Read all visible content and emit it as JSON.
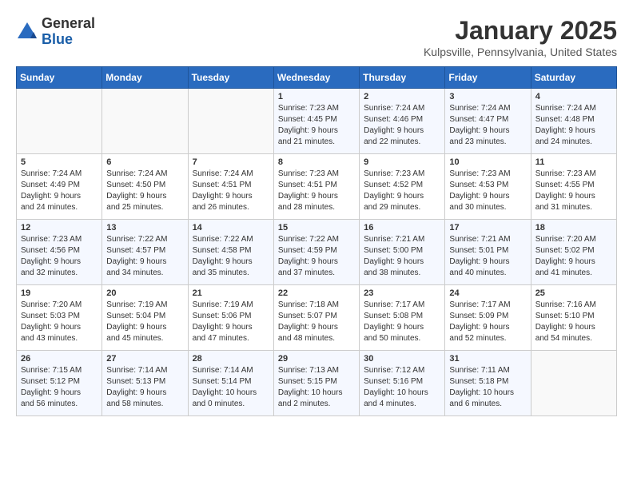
{
  "header": {
    "logo_line1": "General",
    "logo_line2": "Blue",
    "month_title": "January 2025",
    "location": "Kulpsville, Pennsylvania, United States"
  },
  "days_of_week": [
    "Sunday",
    "Monday",
    "Tuesday",
    "Wednesday",
    "Thursday",
    "Friday",
    "Saturday"
  ],
  "weeks": [
    [
      {
        "day": "",
        "info": ""
      },
      {
        "day": "",
        "info": ""
      },
      {
        "day": "",
        "info": ""
      },
      {
        "day": "1",
        "info": "Sunrise: 7:23 AM\nSunset: 4:45 PM\nDaylight: 9 hours\nand 21 minutes."
      },
      {
        "day": "2",
        "info": "Sunrise: 7:24 AM\nSunset: 4:46 PM\nDaylight: 9 hours\nand 22 minutes."
      },
      {
        "day": "3",
        "info": "Sunrise: 7:24 AM\nSunset: 4:47 PM\nDaylight: 9 hours\nand 23 minutes."
      },
      {
        "day": "4",
        "info": "Sunrise: 7:24 AM\nSunset: 4:48 PM\nDaylight: 9 hours\nand 24 minutes."
      }
    ],
    [
      {
        "day": "5",
        "info": "Sunrise: 7:24 AM\nSunset: 4:49 PM\nDaylight: 9 hours\nand 24 minutes."
      },
      {
        "day": "6",
        "info": "Sunrise: 7:24 AM\nSunset: 4:50 PM\nDaylight: 9 hours\nand 25 minutes."
      },
      {
        "day": "7",
        "info": "Sunrise: 7:24 AM\nSunset: 4:51 PM\nDaylight: 9 hours\nand 26 minutes."
      },
      {
        "day": "8",
        "info": "Sunrise: 7:23 AM\nSunset: 4:51 PM\nDaylight: 9 hours\nand 28 minutes."
      },
      {
        "day": "9",
        "info": "Sunrise: 7:23 AM\nSunset: 4:52 PM\nDaylight: 9 hours\nand 29 minutes."
      },
      {
        "day": "10",
        "info": "Sunrise: 7:23 AM\nSunset: 4:53 PM\nDaylight: 9 hours\nand 30 minutes."
      },
      {
        "day": "11",
        "info": "Sunrise: 7:23 AM\nSunset: 4:55 PM\nDaylight: 9 hours\nand 31 minutes."
      }
    ],
    [
      {
        "day": "12",
        "info": "Sunrise: 7:23 AM\nSunset: 4:56 PM\nDaylight: 9 hours\nand 32 minutes."
      },
      {
        "day": "13",
        "info": "Sunrise: 7:22 AM\nSunset: 4:57 PM\nDaylight: 9 hours\nand 34 minutes."
      },
      {
        "day": "14",
        "info": "Sunrise: 7:22 AM\nSunset: 4:58 PM\nDaylight: 9 hours\nand 35 minutes."
      },
      {
        "day": "15",
        "info": "Sunrise: 7:22 AM\nSunset: 4:59 PM\nDaylight: 9 hours\nand 37 minutes."
      },
      {
        "day": "16",
        "info": "Sunrise: 7:21 AM\nSunset: 5:00 PM\nDaylight: 9 hours\nand 38 minutes."
      },
      {
        "day": "17",
        "info": "Sunrise: 7:21 AM\nSunset: 5:01 PM\nDaylight: 9 hours\nand 40 minutes."
      },
      {
        "day": "18",
        "info": "Sunrise: 7:20 AM\nSunset: 5:02 PM\nDaylight: 9 hours\nand 41 minutes."
      }
    ],
    [
      {
        "day": "19",
        "info": "Sunrise: 7:20 AM\nSunset: 5:03 PM\nDaylight: 9 hours\nand 43 minutes."
      },
      {
        "day": "20",
        "info": "Sunrise: 7:19 AM\nSunset: 5:04 PM\nDaylight: 9 hours\nand 45 minutes."
      },
      {
        "day": "21",
        "info": "Sunrise: 7:19 AM\nSunset: 5:06 PM\nDaylight: 9 hours\nand 47 minutes."
      },
      {
        "day": "22",
        "info": "Sunrise: 7:18 AM\nSunset: 5:07 PM\nDaylight: 9 hours\nand 48 minutes."
      },
      {
        "day": "23",
        "info": "Sunrise: 7:17 AM\nSunset: 5:08 PM\nDaylight: 9 hours\nand 50 minutes."
      },
      {
        "day": "24",
        "info": "Sunrise: 7:17 AM\nSunset: 5:09 PM\nDaylight: 9 hours\nand 52 minutes."
      },
      {
        "day": "25",
        "info": "Sunrise: 7:16 AM\nSunset: 5:10 PM\nDaylight: 9 hours\nand 54 minutes."
      }
    ],
    [
      {
        "day": "26",
        "info": "Sunrise: 7:15 AM\nSunset: 5:12 PM\nDaylight: 9 hours\nand 56 minutes."
      },
      {
        "day": "27",
        "info": "Sunrise: 7:14 AM\nSunset: 5:13 PM\nDaylight: 9 hours\nand 58 minutes."
      },
      {
        "day": "28",
        "info": "Sunrise: 7:14 AM\nSunset: 5:14 PM\nDaylight: 10 hours\nand 0 minutes."
      },
      {
        "day": "29",
        "info": "Sunrise: 7:13 AM\nSunset: 5:15 PM\nDaylight: 10 hours\nand 2 minutes."
      },
      {
        "day": "30",
        "info": "Sunrise: 7:12 AM\nSunset: 5:16 PM\nDaylight: 10 hours\nand 4 minutes."
      },
      {
        "day": "31",
        "info": "Sunrise: 7:11 AM\nSunset: 5:18 PM\nDaylight: 10 hours\nand 6 minutes."
      },
      {
        "day": "",
        "info": ""
      }
    ]
  ]
}
